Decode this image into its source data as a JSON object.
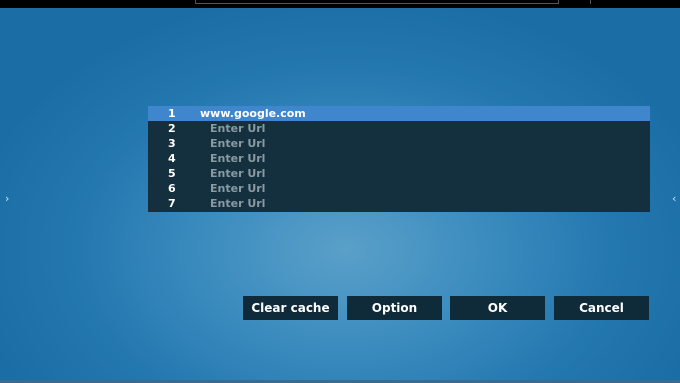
{
  "nav": {
    "left_arrow": "›",
    "right_arrow": "‹"
  },
  "url_list": {
    "items": [
      {
        "number": "1",
        "url": "www.google.com",
        "selected": true
      },
      {
        "number": "2",
        "url": "Enter Url",
        "selected": false
      },
      {
        "number": "3",
        "url": "Enter Url",
        "selected": false
      },
      {
        "number": "4",
        "url": "Enter Url",
        "selected": false
      },
      {
        "number": "5",
        "url": "Enter Url",
        "selected": false
      },
      {
        "number": "6",
        "url": "Enter Url",
        "selected": false
      },
      {
        "number": "7",
        "url": "Enter Url",
        "selected": false
      }
    ]
  },
  "buttons": {
    "clear_cache": "Clear cache",
    "option": "Option",
    "ok": "OK",
    "cancel": "Cancel"
  },
  "colors": {
    "background": "#1a6ea5",
    "list_background": "#14303f",
    "selected_row": "#3f86cc",
    "button_background": "#0f2a38",
    "placeholder_text": "#8a9aa3"
  }
}
